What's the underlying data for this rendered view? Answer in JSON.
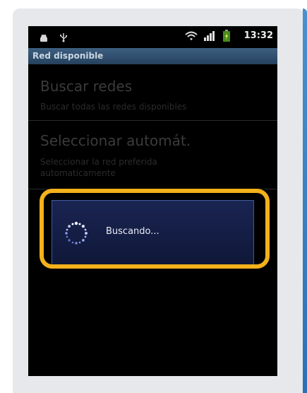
{
  "status_bar": {
    "time": "13:32",
    "icons": [
      "android-debug-icon",
      "usb-icon",
      "wifi-icon",
      "signal-icon",
      "battery-icon"
    ]
  },
  "title_bar": {
    "title": "Red disponible"
  },
  "menu": {
    "items": [
      {
        "title": "Buscar redes",
        "subtitle": "Buscar todas las redes disponibles"
      },
      {
        "title": "Seleccionar automát.",
        "subtitle": "Seleccionar la red preferida automaticamente"
      }
    ]
  },
  "dialog": {
    "message": "Buscando..."
  },
  "colors": {
    "highlight": "#f3b11b",
    "title_bar": "#31506f",
    "dialog_bg": "#141e46"
  }
}
